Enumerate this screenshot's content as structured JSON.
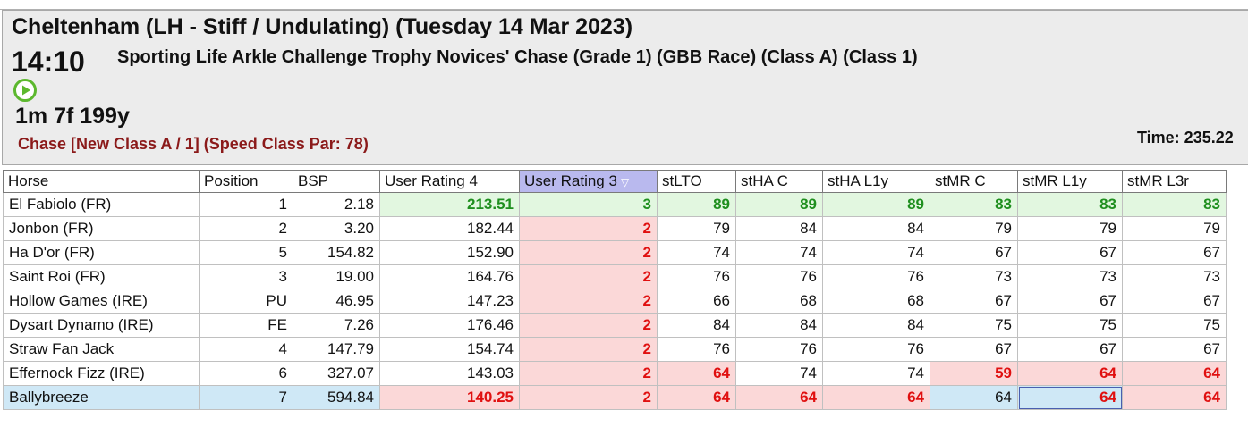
{
  "header": {
    "course": "Cheltenham (LH - Stiff / Undulating)  (Tuesday 14 Mar 2023)",
    "time": "14:10",
    "race_title": "Sporting Life Arkle Challenge Trophy Novices' Chase (Grade 1) (GBB Race) (Class A) (Class 1)",
    "distance": "1m 7f 199y",
    "race_class": "Chase [New Class A / 1]  (Speed Class Par: 78)",
    "time_label": "Time: 235.22",
    "play_icon": "play-circle-icon",
    "accent_green": "#5cb82e"
  },
  "table": {
    "columns": [
      "Horse",
      "Position",
      "BSP",
      "User Rating 4",
      "User Rating 3",
      "stLTO",
      "stHA C",
      "stHA L1y",
      "stMR C",
      "stMR L1y",
      "stMR L3r"
    ],
    "sorted_column": "User Rating 3",
    "rows": [
      {
        "horse": "El Fabiolo (FR)",
        "position": "1",
        "bsp": "2.18",
        "ur4": "213.51",
        "ur3": "3",
        "stlto": "89",
        "stha_c": "89",
        "stha_l1y": "89",
        "stmr_c": "83",
        "stmr_l1y": "83",
        "stmr_l3r": "83"
      },
      {
        "horse": "Jonbon (FR)",
        "position": "2",
        "bsp": "3.20",
        "ur4": "182.44",
        "ur3": "2",
        "stlto": "79",
        "stha_c": "84",
        "stha_l1y": "84",
        "stmr_c": "79",
        "stmr_l1y": "79",
        "stmr_l3r": "79"
      },
      {
        "horse": "Ha D'or (FR)",
        "position": "5",
        "bsp": "154.82",
        "ur4": "152.90",
        "ur3": "2",
        "stlto": "74",
        "stha_c": "74",
        "stha_l1y": "74",
        "stmr_c": "67",
        "stmr_l1y": "67",
        "stmr_l3r": "67"
      },
      {
        "horse": "Saint Roi (FR)",
        "position": "3",
        "bsp": "19.00",
        "ur4": "164.76",
        "ur3": "2",
        "stlto": "76",
        "stha_c": "76",
        "stha_l1y": "76",
        "stmr_c": "73",
        "stmr_l1y": "73",
        "stmr_l3r": "73"
      },
      {
        "horse": "Hollow Games (IRE)",
        "position": "PU",
        "bsp": "46.95",
        "ur4": "147.23",
        "ur3": "2",
        "stlto": "66",
        "stha_c": "68",
        "stha_l1y": "68",
        "stmr_c": "67",
        "stmr_l1y": "67",
        "stmr_l3r": "67"
      },
      {
        "horse": "Dysart Dynamo (IRE)",
        "position": "FE",
        "bsp": "7.26",
        "ur4": "176.46",
        "ur3": "2",
        "stlto": "84",
        "stha_c": "84",
        "stha_l1y": "84",
        "stmr_c": "75",
        "stmr_l1y": "75",
        "stmr_l3r": "75"
      },
      {
        "horse": "Straw Fan Jack",
        "position": "4",
        "bsp": "147.79",
        "ur4": "154.74",
        "ur3": "2",
        "stlto": "76",
        "stha_c": "76",
        "stha_l1y": "76",
        "stmr_c": "67",
        "stmr_l1y": "67",
        "stmr_l3r": "67"
      },
      {
        "horse": "Effernock Fizz (IRE)",
        "position": "6",
        "bsp": "327.07",
        "ur4": "143.03",
        "ur3": "2",
        "stlto": "64",
        "stha_c": "74",
        "stha_l1y": "74",
        "stmr_c": "59",
        "stmr_l1y": "64",
        "stmr_l3r": "64"
      },
      {
        "horse": "Ballybreeze",
        "position": "7",
        "bsp": "594.84",
        "ur4": "140.25",
        "ur3": "2",
        "stlto": "64",
        "stha_c": "64",
        "stha_l1y": "64",
        "stmr_c": "64",
        "stmr_l1y": "64",
        "stmr_l3r": "64"
      }
    ]
  },
  "colors": {
    "good_bg": "#e2f7e0",
    "good_text": "#1f8f1f",
    "bad_bg": "#fbd8d8",
    "bad_text": "#e01010",
    "selected_bg": "#cfe8f6",
    "sorted_header_bg": "#b9b9ee",
    "class_text": "#8b1a1a"
  }
}
